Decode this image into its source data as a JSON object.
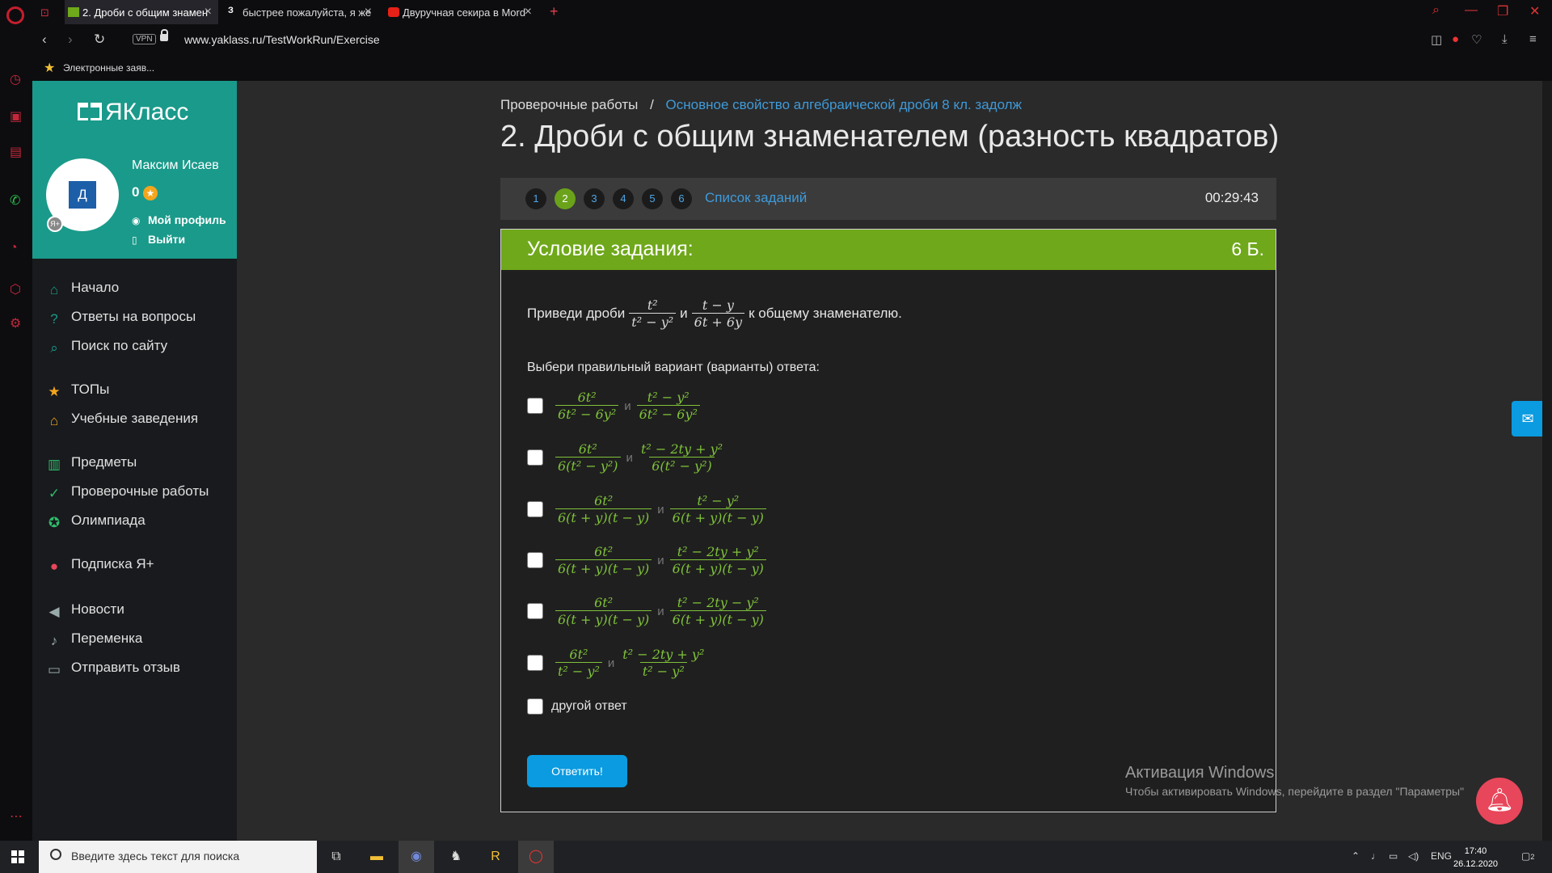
{
  "browser": {
    "tabs": [
      {
        "label": "2. Дроби с общим знамен",
        "active": true
      },
      {
        "label": "быстрее пожалуйста, я же",
        "active": false
      },
      {
        "label": "Двуручная секира в Mord",
        "active": false
      }
    ],
    "url": "www.yaklass.ru/TestWorkRun/Exercise",
    "vpn_label": "VPN",
    "bookmark": "Электронные заяв..."
  },
  "site": {
    "logo": "ЯКласс",
    "user": {
      "name": "Максим Исаев",
      "points": "0",
      "avatar_letter": "Д",
      "profile_link": "Мой профиль",
      "logout_link": "Выйти"
    },
    "nav": [
      {
        "label": "Начало",
        "icon": "home-icon"
      },
      {
        "label": "Ответы на вопросы",
        "icon": "question-icon"
      },
      {
        "label": "Поиск по сайту",
        "icon": "search-icon"
      },
      {
        "label": "ТОПы",
        "icon": "star-icon"
      },
      {
        "label": "Учебные заведения",
        "icon": "school-icon"
      },
      {
        "label": "Предметы",
        "icon": "books-icon"
      },
      {
        "label": "Проверочные работы",
        "icon": "check-icon"
      },
      {
        "label": "Олимпиада",
        "icon": "medal-icon"
      },
      {
        "label": "Подписка Я+",
        "icon": "subscription-icon"
      },
      {
        "label": "Новости",
        "icon": "megaphone-icon"
      },
      {
        "label": "Переменка",
        "icon": "bell-icon"
      },
      {
        "label": "Отправить отзыв",
        "icon": "feedback-icon"
      }
    ]
  },
  "breadcrumb": {
    "root": "Проверочные работы",
    "separator": "/",
    "current": "Основное свойство алгебраической дроби 8 кл. задолж"
  },
  "title": "2. Дроби с общим знаменателем (разность квадратов)",
  "task_nav": {
    "numbers": [
      "1",
      "2",
      "3",
      "4",
      "5",
      "6"
    ],
    "active": "2",
    "list_link": "Список заданий",
    "timer": "00:29:43"
  },
  "task": {
    "header": "Условие задания:",
    "points": "6 Б.",
    "question": {
      "before": "Приведи дроби",
      "and": "и",
      "after": "к общему знаменателю.",
      "f1": {
        "num": "t²",
        "den": "t² − y²"
      },
      "f2": {
        "num": "t − y",
        "den": "6t + 6y"
      }
    },
    "prompt": "Выбери правильный вариант (варианты) ответа:",
    "and_word": "и",
    "options": [
      {
        "a": {
          "num": "6t²",
          "den": "6t² − 6y²"
        },
        "b": {
          "num": "t² − y²",
          "den": "6t² − 6y²"
        }
      },
      {
        "a": {
          "num": "6t²",
          "den": "6(t² − y²)"
        },
        "b": {
          "num": "t² − 2ty + y²",
          "den": "6(t² − y²)"
        }
      },
      {
        "a": {
          "num": "6t²",
          "den": "6(t + y)(t − y)"
        },
        "b": {
          "num": "t² − y²",
          "den": "6(t + y)(t − y)"
        }
      },
      {
        "a": {
          "num": "6t²",
          "den": "6(t + y)(t − y)"
        },
        "b": {
          "num": "t² − 2ty + y²",
          "den": "6(t + y)(t − y)"
        }
      },
      {
        "a": {
          "num": "6t²",
          "den": "6(t + y)(t − y)"
        },
        "b": {
          "num": "t² − 2ty − y²",
          "den": "6(t + y)(t − y)"
        }
      },
      {
        "a": {
          "num": "6t²",
          "den": "t² − y²"
        },
        "b": {
          "num": "t² − 2ty + y²",
          "den": "t² − y²"
        }
      }
    ],
    "other_option": "другой ответ",
    "submit": "Ответить!"
  },
  "watermark": {
    "title": "Активация Windows",
    "subtitle": "Чтобы активировать Windows, перейдите в раздел \"Параметры\""
  },
  "taskbar": {
    "search_placeholder": "Введите здесь текст для поиска",
    "lang": "ENG",
    "time": "17:40",
    "date": "26.12.2020",
    "notifications": "2"
  }
}
